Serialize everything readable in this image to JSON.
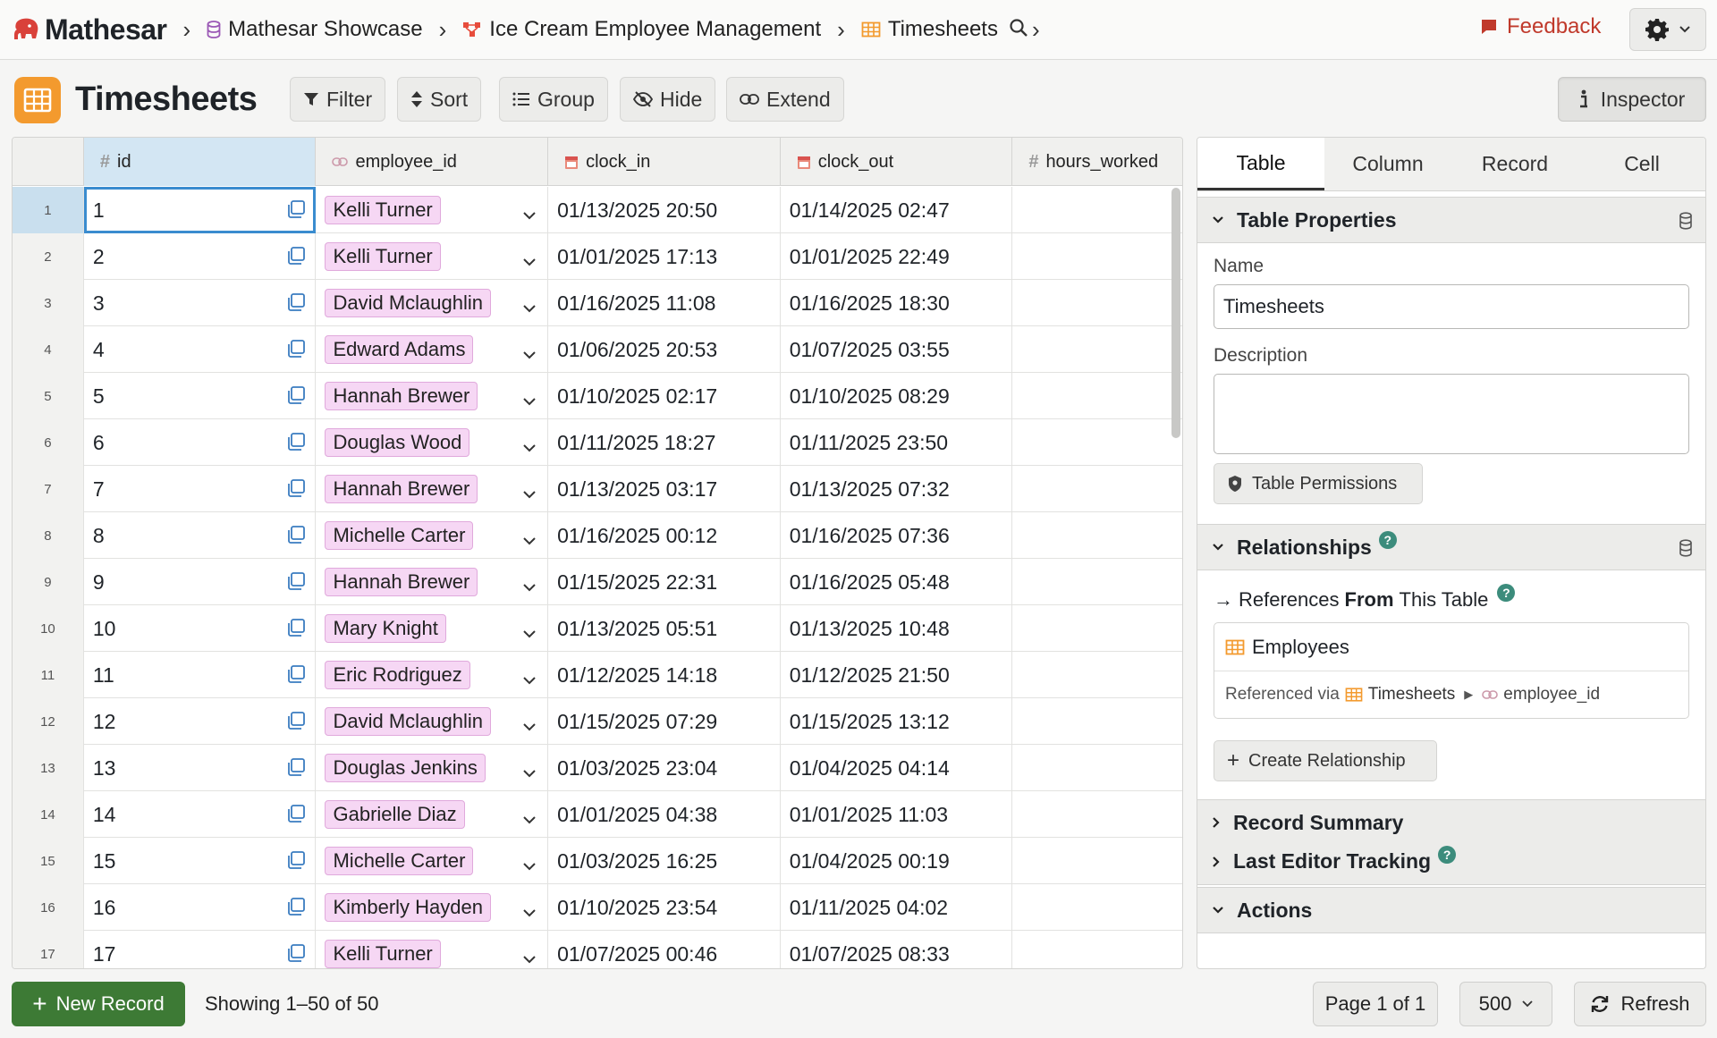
{
  "app": {
    "name": "Mathesar"
  },
  "breadcrumb": {
    "database": "Mathesar Showcase",
    "schema": "Ice Cream Employee Management",
    "table": "Timesheets"
  },
  "topbar": {
    "feedback_label": "Feedback"
  },
  "page": {
    "title": "Timesheets"
  },
  "toolbar": {
    "filter": "Filter",
    "sort": "Sort",
    "group": "Group",
    "hide": "Hide",
    "extend": "Extend",
    "inspector": "Inspector"
  },
  "columns": [
    "id",
    "employee_id",
    "clock_in",
    "clock_out",
    "hours_worked"
  ],
  "rows": [
    {
      "n": "1",
      "id": "1",
      "employee": "Kelli Turner",
      "clock_in": "01/13/2025 20:50",
      "clock_out": "01/14/2025 02:47"
    },
    {
      "n": "2",
      "id": "2",
      "employee": "Kelli Turner",
      "clock_in": "01/01/2025 17:13",
      "clock_out": "01/01/2025 22:49"
    },
    {
      "n": "3",
      "id": "3",
      "employee": "David Mclaughlin",
      "clock_in": "01/16/2025 11:08",
      "clock_out": "01/16/2025 18:30"
    },
    {
      "n": "4",
      "id": "4",
      "employee": "Edward Adams",
      "clock_in": "01/06/2025 20:53",
      "clock_out": "01/07/2025 03:55"
    },
    {
      "n": "5",
      "id": "5",
      "employee": "Hannah Brewer",
      "clock_in": "01/10/2025 02:17",
      "clock_out": "01/10/2025 08:29"
    },
    {
      "n": "6",
      "id": "6",
      "employee": "Douglas Wood",
      "clock_in": "01/11/2025 18:27",
      "clock_out": "01/11/2025 23:50"
    },
    {
      "n": "7",
      "id": "7",
      "employee": "Hannah Brewer",
      "clock_in": "01/13/2025 03:17",
      "clock_out": "01/13/2025 07:32"
    },
    {
      "n": "8",
      "id": "8",
      "employee": "Michelle Carter",
      "clock_in": "01/16/2025 00:12",
      "clock_out": "01/16/2025 07:36"
    },
    {
      "n": "9",
      "id": "9",
      "employee": "Hannah Brewer",
      "clock_in": "01/15/2025 22:31",
      "clock_out": "01/16/2025 05:48"
    },
    {
      "n": "10",
      "id": "10",
      "employee": "Mary Knight",
      "clock_in": "01/13/2025 05:51",
      "clock_out": "01/13/2025 10:48"
    },
    {
      "n": "11",
      "id": "11",
      "employee": "Eric Rodriguez",
      "clock_in": "01/12/2025 14:18",
      "clock_out": "01/12/2025 21:50"
    },
    {
      "n": "12",
      "id": "12",
      "employee": "David Mclaughlin",
      "clock_in": "01/15/2025 07:29",
      "clock_out": "01/15/2025 13:12"
    },
    {
      "n": "13",
      "id": "13",
      "employee": "Douglas Jenkins",
      "clock_in": "01/03/2025 23:04",
      "clock_out": "01/04/2025 04:14"
    },
    {
      "n": "14",
      "id": "14",
      "employee": "Gabrielle Diaz",
      "clock_in": "01/01/2025 04:38",
      "clock_out": "01/01/2025 11:03"
    },
    {
      "n": "15",
      "id": "15",
      "employee": "Michelle Carter",
      "clock_in": "01/03/2025 16:25",
      "clock_out": "01/04/2025 00:19"
    },
    {
      "n": "16",
      "id": "16",
      "employee": "Kimberly Hayden",
      "clock_in": "01/10/2025 23:54",
      "clock_out": "01/11/2025 04:02"
    },
    {
      "n": "17",
      "id": "17",
      "employee": "Kelli Turner",
      "clock_in": "01/07/2025 00:46",
      "clock_out": "01/07/2025 08:33"
    }
  ],
  "inspector": {
    "tabs": [
      "Table",
      "Column",
      "Record",
      "Cell"
    ],
    "table_properties": "Table Properties",
    "name_label": "Name",
    "name_value": "Timesheets",
    "description_label": "Description",
    "permissions": "Table Permissions",
    "relationships": "Relationships",
    "refs_prefix": "References",
    "refs_bold": "From",
    "refs_suffix": "This Table",
    "ref_table": "Employees",
    "referenced_via": "Referenced via",
    "via_table": "Timesheets",
    "via_column": "employee_id",
    "create_relationship": "Create Relationship",
    "record_summary": "Record Summary",
    "last_editor": "Last Editor Tracking",
    "actions": "Actions",
    "help_glyph": "?"
  },
  "footer": {
    "new_record": "New Record",
    "showing": "Showing 1–50 of 50",
    "page": "Page 1 of 1",
    "page_size": "500",
    "refresh": "Refresh"
  },
  "colors": {
    "accent": "#3a8ccf",
    "brand": "#c0392b",
    "table_icon": "#f39a2e",
    "chip": "#f6d7f4",
    "new_record": "#3d7a35"
  }
}
